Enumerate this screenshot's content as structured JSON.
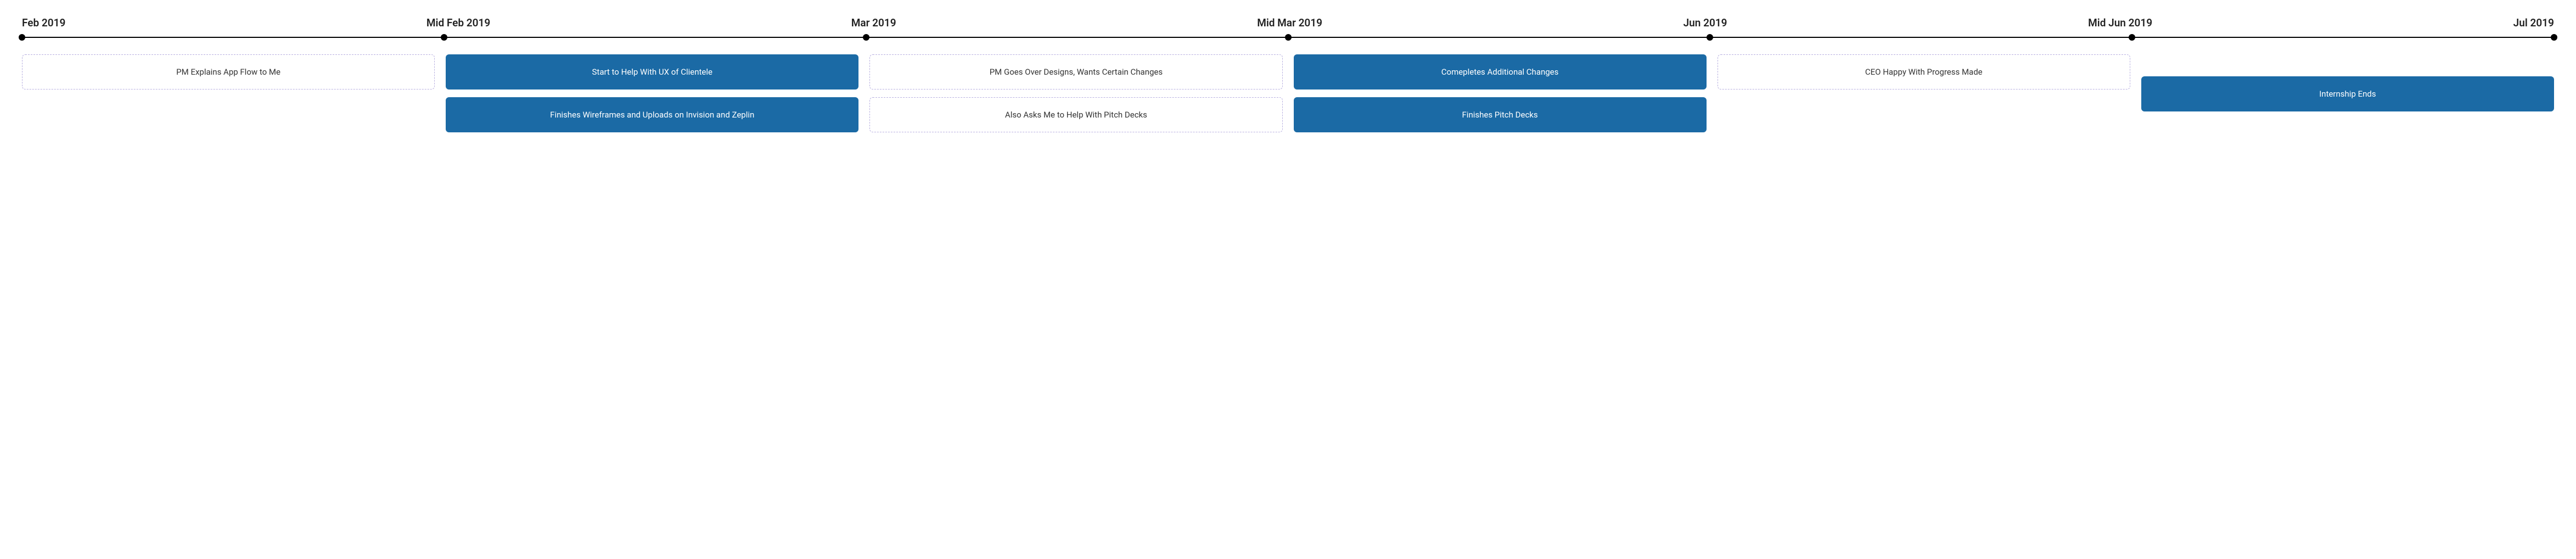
{
  "timeline": {
    "labels": [
      "Feb 2019",
      "Mid Feb 2019",
      "Mar 2019",
      "Mid Mar 2019",
      "Jun 2019",
      "Mid Jun 2019",
      "Jul 2019"
    ],
    "columns": [
      {
        "cards": [
          {
            "style": "dashed",
            "text": "PM Explains App Flow to Me"
          }
        ]
      },
      {
        "cards": [
          {
            "style": "solid",
            "text": "Start to Help With UX of Clientele"
          },
          {
            "style": "solid",
            "text": "Finishes Wireframes and Uploads on Invision and Zeplin"
          }
        ]
      },
      {
        "cards": [
          {
            "style": "dashed",
            "text": "PM Goes Over Designs, Wants Certain Changes"
          },
          {
            "style": "dashed",
            "text": "Also Asks Me to Help With Pitch Decks"
          }
        ]
      },
      {
        "cards": [
          {
            "style": "solid",
            "text": "Comepletes Additional Changes"
          },
          {
            "style": "solid",
            "text": "Finishes Pitch Decks"
          }
        ]
      },
      {
        "cards": [
          {
            "style": "dashed",
            "text": "CEO Happy With Progress Made"
          }
        ]
      },
      {
        "offset": "half",
        "cards": [
          {
            "style": "solid",
            "text": "Internship Ends"
          }
        ]
      }
    ]
  },
  "chart_data": {
    "type": "timeline",
    "title": "",
    "points": [
      {
        "date": "Feb 2019",
        "events": [
          {
            "text": "PM Explains App Flow to Me",
            "emphasis": false
          }
        ]
      },
      {
        "date": "Mid Feb 2019",
        "events": [
          {
            "text": "Start to Help With UX of Clientele",
            "emphasis": true
          },
          {
            "text": "Finishes Wireframes and Uploads on Invision and Zeplin",
            "emphasis": true
          }
        ]
      },
      {
        "date": "Mar 2019",
        "events": [
          {
            "text": "PM Goes Over Designs, Wants Certain Changes",
            "emphasis": false
          },
          {
            "text": "Also Asks Me to Help With Pitch Decks",
            "emphasis": false
          }
        ]
      },
      {
        "date": "Mid Mar 2019",
        "events": [
          {
            "text": "Comepletes Additional Changes",
            "emphasis": true
          },
          {
            "text": "Finishes Pitch Decks",
            "emphasis": true
          }
        ]
      },
      {
        "date": "Jun 2019",
        "events": [
          {
            "text": "CEO Happy With Progress Made",
            "emphasis": false
          }
        ]
      },
      {
        "date": "Mid Jun 2019",
        "events": []
      },
      {
        "date": "Jul 2019",
        "events": [
          {
            "text": "Internship Ends",
            "emphasis": true
          }
        ]
      }
    ]
  }
}
